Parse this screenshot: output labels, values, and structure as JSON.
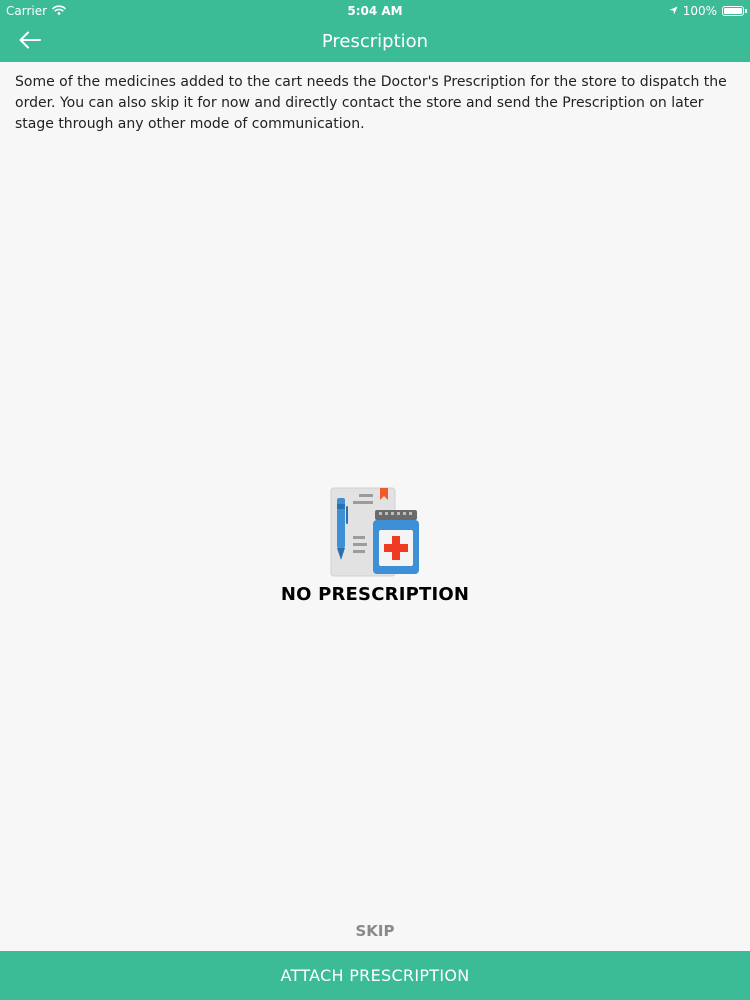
{
  "colors": {
    "accent": "#3bbc96",
    "background": "#f7f7f7",
    "body_text": "#222222",
    "skip_text": "#8a8a8a"
  },
  "status_bar": {
    "carrier": "Carrier",
    "time": "5:04 AM",
    "battery_text": "100%",
    "battery_level": 1.0,
    "icons": [
      "wifi-icon",
      "location-arrow-icon",
      "battery-icon"
    ]
  },
  "nav": {
    "title": "Prescription",
    "back_icon": "back-arrow-icon"
  },
  "info": {
    "text": "Some of the medicines added to the cart needs the Doctor's Prescription for the store to dispatch the order. You can also skip it for now and directly contact the store and send the Prescription on later stage through any other mode of communication."
  },
  "empty_state": {
    "icon": "prescription-bottle-icon",
    "title": "NO PRESCRIPTION"
  },
  "actions": {
    "skip_label": "SKIP",
    "attach_label": "ATTACH PRESCRIPTION"
  }
}
